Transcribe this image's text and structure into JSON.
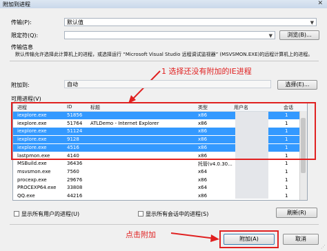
{
  "window": {
    "title": "附加到进程",
    "close": "✕"
  },
  "transport": {
    "label": "传输(P):",
    "value": "默认值"
  },
  "qualifier": {
    "label": "限定符(Q):",
    "value": "",
    "browse": "浏览(B)..."
  },
  "transport_info": {
    "heading": "传输信息",
    "text": "默认传输允许选择此计算机上的进程，或选择运行 “Microsoft Visual Studio 远程调试监视器” (MSVSMON.EXE)的远程计算机上的进程。"
  },
  "attach_to": {
    "label": "附加到:",
    "value": "自动",
    "select": "选择(E)..."
  },
  "available": {
    "label": "可用进程(V)"
  },
  "table": {
    "columns": [
      "进程",
      "ID",
      "标题",
      "类型",
      "用户名",
      "会话"
    ],
    "rows": [
      {
        "process": "iexplore.exe",
        "id": "51856",
        "title": "",
        "type": "x86",
        "session": "1",
        "selected": true
      },
      {
        "process": "iexplore.exe",
        "id": "51764",
        "title": "ATLDemo - Internet Explorer",
        "type": "x86",
        "session": "1",
        "selected": false
      },
      {
        "process": "iexplore.exe",
        "id": "51124",
        "title": "",
        "type": "x86",
        "session": "1",
        "selected": true
      },
      {
        "process": "iexplore.exe",
        "id": "9128",
        "title": "",
        "type": "x86",
        "session": "1",
        "selected": true
      },
      {
        "process": "iexplore.exe",
        "id": "4516",
        "title": "",
        "type": "x86",
        "session": "1",
        "selected": true
      },
      {
        "process": "lastpmon.exe",
        "id": "4140",
        "title": "",
        "type": "x86",
        "session": "1",
        "selected": false
      },
      {
        "process": "MSBuild.exe",
        "id": "36436",
        "title": "",
        "type": "托管(v4.0.30...",
        "session": "1",
        "selected": false
      },
      {
        "process": "msvsmon.exe",
        "id": "7560",
        "title": "",
        "type": "x64",
        "session": "1",
        "selected": false
      },
      {
        "process": "procexp.exe",
        "id": "29676",
        "title": "",
        "type": "x86",
        "session": "1",
        "selected": false
      },
      {
        "process": "PROCEXP64.exe",
        "id": "33808",
        "title": "",
        "type": "x64",
        "session": "1",
        "selected": false
      },
      {
        "process": "QQ.exe",
        "id": "44216",
        "title": "",
        "type": "x86",
        "session": "1",
        "selected": false
      }
    ]
  },
  "options": {
    "all_users": "显示所有用户的进程(U)",
    "all_sessions": "显示所有会话中的进程(S)",
    "refresh": "刷新(R)"
  },
  "footer": {
    "attach": "附加(A)",
    "cancel": "取消"
  },
  "annotations": {
    "step1": "1 选择还没有附加的IE进程",
    "click_attach": "点击附加"
  },
  "colors": {
    "annotation": "#e02020",
    "selection": "#3399ff"
  }
}
